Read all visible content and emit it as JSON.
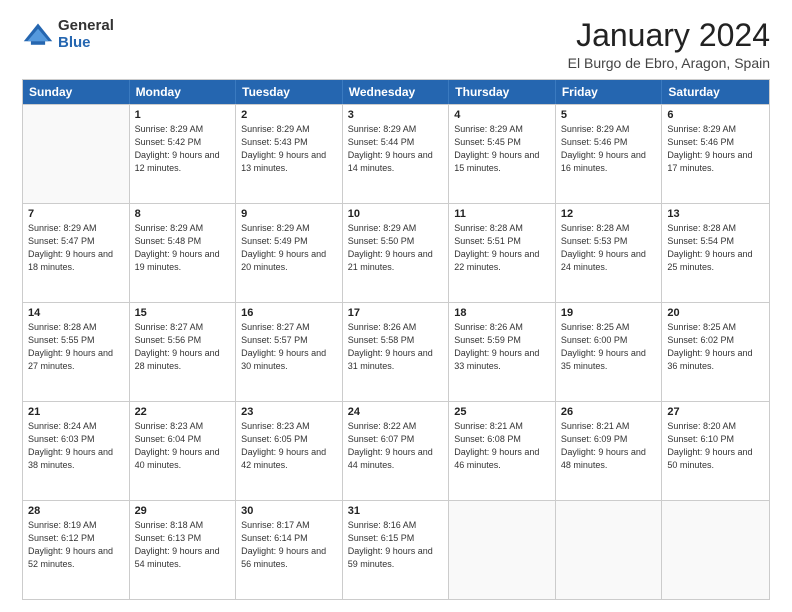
{
  "logo": {
    "general": "General",
    "blue": "Blue"
  },
  "title": "January 2024",
  "location": "El Burgo de Ebro, Aragon, Spain",
  "header_days": [
    "Sunday",
    "Monday",
    "Tuesday",
    "Wednesday",
    "Thursday",
    "Friday",
    "Saturday"
  ],
  "weeks": [
    [
      {
        "day": "",
        "sunrise": "",
        "sunset": "",
        "daylight": ""
      },
      {
        "day": "1",
        "sunrise": "Sunrise: 8:29 AM",
        "sunset": "Sunset: 5:42 PM",
        "daylight": "Daylight: 9 hours and 12 minutes."
      },
      {
        "day": "2",
        "sunrise": "Sunrise: 8:29 AM",
        "sunset": "Sunset: 5:43 PM",
        "daylight": "Daylight: 9 hours and 13 minutes."
      },
      {
        "day": "3",
        "sunrise": "Sunrise: 8:29 AM",
        "sunset": "Sunset: 5:44 PM",
        "daylight": "Daylight: 9 hours and 14 minutes."
      },
      {
        "day": "4",
        "sunrise": "Sunrise: 8:29 AM",
        "sunset": "Sunset: 5:45 PM",
        "daylight": "Daylight: 9 hours and 15 minutes."
      },
      {
        "day": "5",
        "sunrise": "Sunrise: 8:29 AM",
        "sunset": "Sunset: 5:46 PM",
        "daylight": "Daylight: 9 hours and 16 minutes."
      },
      {
        "day": "6",
        "sunrise": "Sunrise: 8:29 AM",
        "sunset": "Sunset: 5:46 PM",
        "daylight": "Daylight: 9 hours and 17 minutes."
      }
    ],
    [
      {
        "day": "7",
        "sunrise": "Sunrise: 8:29 AM",
        "sunset": "Sunset: 5:47 PM",
        "daylight": "Daylight: 9 hours and 18 minutes."
      },
      {
        "day": "8",
        "sunrise": "Sunrise: 8:29 AM",
        "sunset": "Sunset: 5:48 PM",
        "daylight": "Daylight: 9 hours and 19 minutes."
      },
      {
        "day": "9",
        "sunrise": "Sunrise: 8:29 AM",
        "sunset": "Sunset: 5:49 PM",
        "daylight": "Daylight: 9 hours and 20 minutes."
      },
      {
        "day": "10",
        "sunrise": "Sunrise: 8:29 AM",
        "sunset": "Sunset: 5:50 PM",
        "daylight": "Daylight: 9 hours and 21 minutes."
      },
      {
        "day": "11",
        "sunrise": "Sunrise: 8:28 AM",
        "sunset": "Sunset: 5:51 PM",
        "daylight": "Daylight: 9 hours and 22 minutes."
      },
      {
        "day": "12",
        "sunrise": "Sunrise: 8:28 AM",
        "sunset": "Sunset: 5:53 PM",
        "daylight": "Daylight: 9 hours and 24 minutes."
      },
      {
        "day": "13",
        "sunrise": "Sunrise: 8:28 AM",
        "sunset": "Sunset: 5:54 PM",
        "daylight": "Daylight: 9 hours and 25 minutes."
      }
    ],
    [
      {
        "day": "14",
        "sunrise": "Sunrise: 8:28 AM",
        "sunset": "Sunset: 5:55 PM",
        "daylight": "Daylight: 9 hours and 27 minutes."
      },
      {
        "day": "15",
        "sunrise": "Sunrise: 8:27 AM",
        "sunset": "Sunset: 5:56 PM",
        "daylight": "Daylight: 9 hours and 28 minutes."
      },
      {
        "day": "16",
        "sunrise": "Sunrise: 8:27 AM",
        "sunset": "Sunset: 5:57 PM",
        "daylight": "Daylight: 9 hours and 30 minutes."
      },
      {
        "day": "17",
        "sunrise": "Sunrise: 8:26 AM",
        "sunset": "Sunset: 5:58 PM",
        "daylight": "Daylight: 9 hours and 31 minutes."
      },
      {
        "day": "18",
        "sunrise": "Sunrise: 8:26 AM",
        "sunset": "Sunset: 5:59 PM",
        "daylight": "Daylight: 9 hours and 33 minutes."
      },
      {
        "day": "19",
        "sunrise": "Sunrise: 8:25 AM",
        "sunset": "Sunset: 6:00 PM",
        "daylight": "Daylight: 9 hours and 35 minutes."
      },
      {
        "day": "20",
        "sunrise": "Sunrise: 8:25 AM",
        "sunset": "Sunset: 6:02 PM",
        "daylight": "Daylight: 9 hours and 36 minutes."
      }
    ],
    [
      {
        "day": "21",
        "sunrise": "Sunrise: 8:24 AM",
        "sunset": "Sunset: 6:03 PM",
        "daylight": "Daylight: 9 hours and 38 minutes."
      },
      {
        "day": "22",
        "sunrise": "Sunrise: 8:23 AM",
        "sunset": "Sunset: 6:04 PM",
        "daylight": "Daylight: 9 hours and 40 minutes."
      },
      {
        "day": "23",
        "sunrise": "Sunrise: 8:23 AM",
        "sunset": "Sunset: 6:05 PM",
        "daylight": "Daylight: 9 hours and 42 minutes."
      },
      {
        "day": "24",
        "sunrise": "Sunrise: 8:22 AM",
        "sunset": "Sunset: 6:07 PM",
        "daylight": "Daylight: 9 hours and 44 minutes."
      },
      {
        "day": "25",
        "sunrise": "Sunrise: 8:21 AM",
        "sunset": "Sunset: 6:08 PM",
        "daylight": "Daylight: 9 hours and 46 minutes."
      },
      {
        "day": "26",
        "sunrise": "Sunrise: 8:21 AM",
        "sunset": "Sunset: 6:09 PM",
        "daylight": "Daylight: 9 hours and 48 minutes."
      },
      {
        "day": "27",
        "sunrise": "Sunrise: 8:20 AM",
        "sunset": "Sunset: 6:10 PM",
        "daylight": "Daylight: 9 hours and 50 minutes."
      }
    ],
    [
      {
        "day": "28",
        "sunrise": "Sunrise: 8:19 AM",
        "sunset": "Sunset: 6:12 PM",
        "daylight": "Daylight: 9 hours and 52 minutes."
      },
      {
        "day": "29",
        "sunrise": "Sunrise: 8:18 AM",
        "sunset": "Sunset: 6:13 PM",
        "daylight": "Daylight: 9 hours and 54 minutes."
      },
      {
        "day": "30",
        "sunrise": "Sunrise: 8:17 AM",
        "sunset": "Sunset: 6:14 PM",
        "daylight": "Daylight: 9 hours and 56 minutes."
      },
      {
        "day": "31",
        "sunrise": "Sunrise: 8:16 AM",
        "sunset": "Sunset: 6:15 PM",
        "daylight": "Daylight: 9 hours and 59 minutes."
      },
      {
        "day": "",
        "sunrise": "",
        "sunset": "",
        "daylight": ""
      },
      {
        "day": "",
        "sunrise": "",
        "sunset": "",
        "daylight": ""
      },
      {
        "day": "",
        "sunrise": "",
        "sunset": "",
        "daylight": ""
      }
    ]
  ]
}
